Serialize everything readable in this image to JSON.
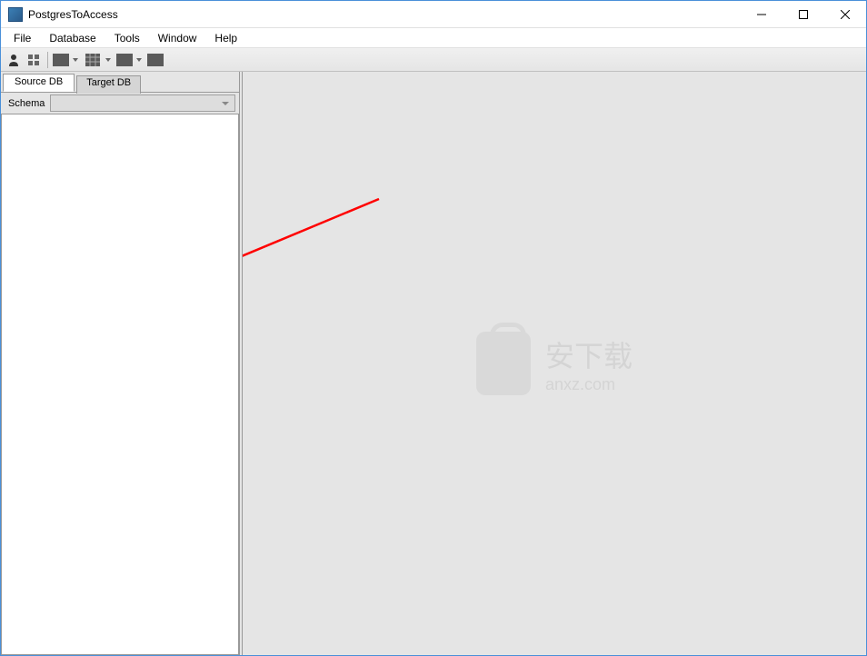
{
  "titlebar": {
    "title": "PostgresToAccess"
  },
  "menubar": {
    "items": [
      "File",
      "Database",
      "Tools",
      "Window",
      "Help"
    ]
  },
  "sidebar": {
    "tabs": [
      {
        "label": "Source DB",
        "active": true
      },
      {
        "label": "Target DB",
        "active": false
      }
    ],
    "schema_label": "Schema",
    "schema_value": ""
  },
  "watermark": {
    "text": "安下载",
    "subtext": "anxz.com"
  }
}
